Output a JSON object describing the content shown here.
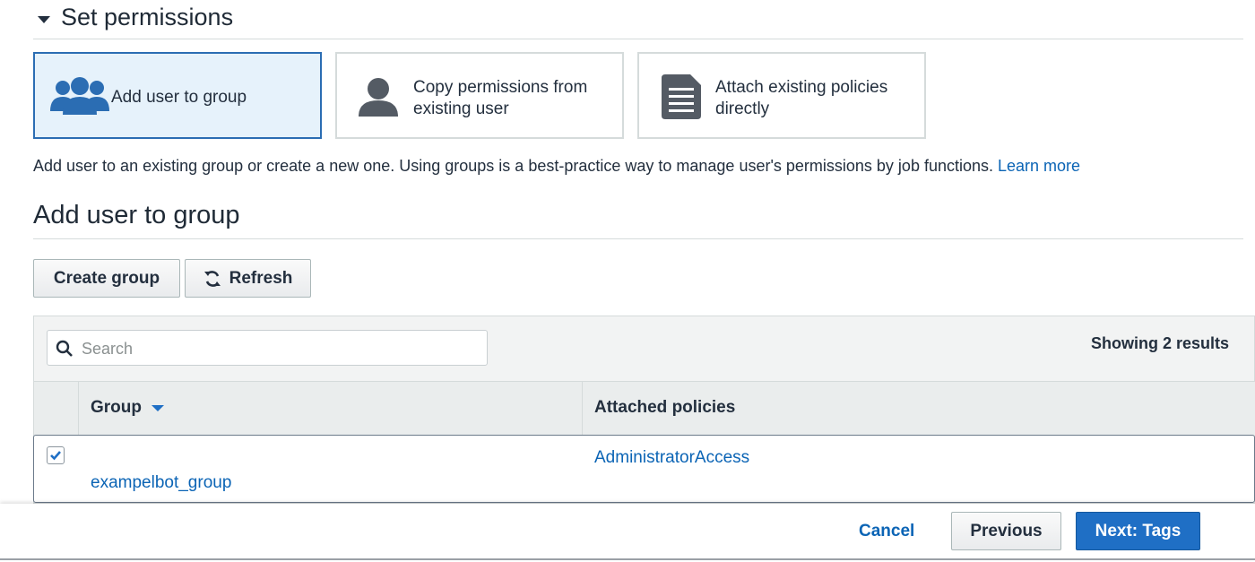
{
  "section": {
    "title": "Set permissions"
  },
  "options": [
    {
      "label_line1": "Add user to group",
      "label_line2": "",
      "icon": "users-group-icon"
    },
    {
      "label_line1": "Copy permissions from",
      "label_line2": "existing user",
      "icon": "user-silhouette-icon"
    },
    {
      "label_line1": "Attach existing policies",
      "label_line2": "directly",
      "icon": "document-icon"
    }
  ],
  "description": {
    "text": "Add user to an existing group or create a new one. Using groups is a best-practice way to manage user's permissions by job functions.",
    "link": "Learn more"
  },
  "subheading": "Add user to group",
  "toolbar": {
    "create_group": "Create group",
    "refresh": "Refresh",
    "refresh_icon": "refresh-icon"
  },
  "search": {
    "placeholder": "Search",
    "icon": "search-icon"
  },
  "results_text": "Showing 2 results",
  "table": {
    "columns": [
      "Group",
      "Attached policies"
    ],
    "sort_icon": "sort-caret-down-icon",
    "rows": [
      {
        "checked": true,
        "group": "exampelbot_group",
        "policy": "AdministratorAccess"
      }
    ]
  },
  "footer": {
    "cancel": "Cancel",
    "previous": "Previous",
    "next": "Next: Tags"
  },
  "colors": {
    "link": "#0b64b5",
    "primary": "#1f6fc5",
    "selected_border": "#2b6db3",
    "selected_bg": "#e6f2fb"
  }
}
